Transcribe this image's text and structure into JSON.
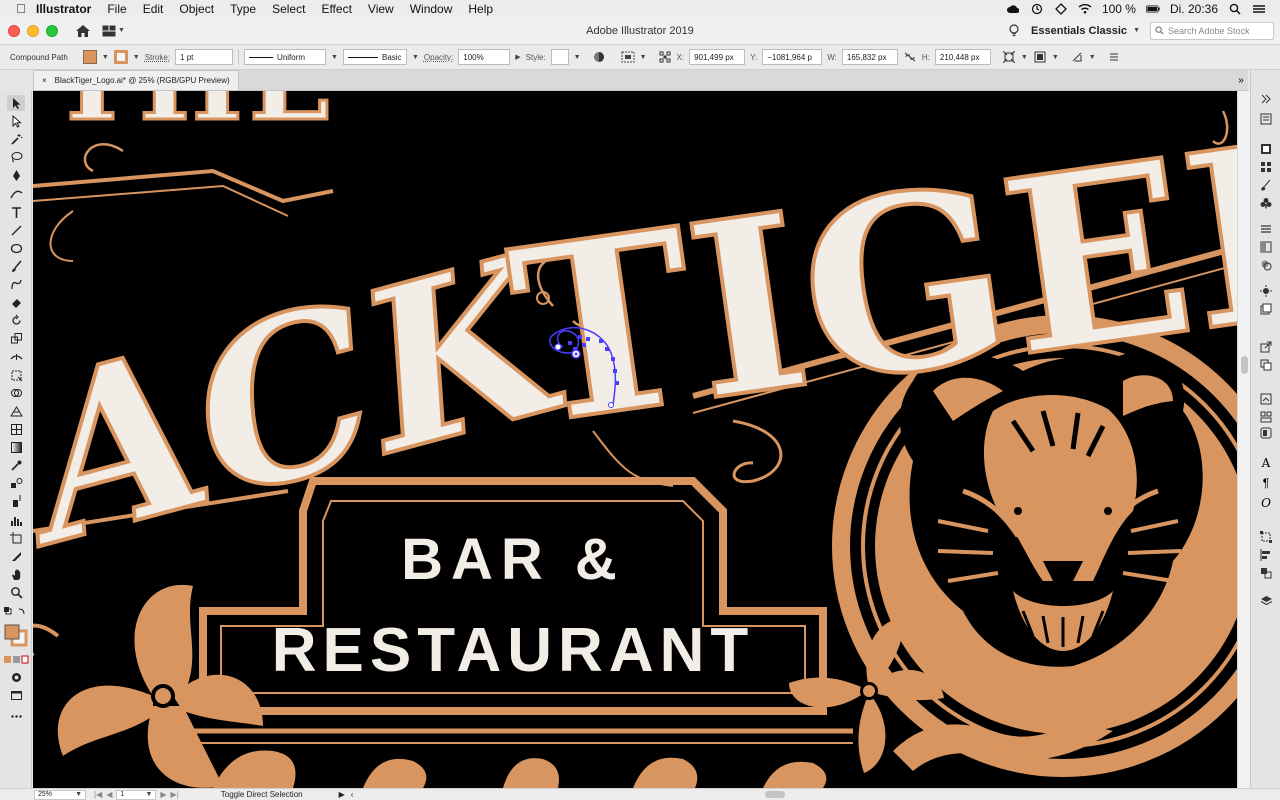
{
  "menubar": {
    "app_name": "Illustrator",
    "items": [
      "File",
      "Edit",
      "Object",
      "Type",
      "Select",
      "Effect",
      "View",
      "Window",
      "Help"
    ],
    "battery": "100 %",
    "clock": "Di. 20:36"
  },
  "titlebar": {
    "title": "Adobe Illustrator 2019",
    "workspace": "Essentials Classic",
    "search_placeholder": "Search Adobe Stock"
  },
  "controlbar": {
    "selection_type": "Compound Path",
    "stroke_label": "Stroke:",
    "stroke_value": "1 pt",
    "profile": "Uniform",
    "brush": "Basic",
    "opacity_label": "Opacity:",
    "opacity_value": "100%",
    "style_label": "Style:",
    "x_label": "X:",
    "x_value": "901,499 px",
    "y_label": "Y:",
    "y_value": "−1081,964 p",
    "w_label": "W:",
    "w_value": "165,832 px",
    "h_label": "H:",
    "h_value": "210,448 px",
    "fill_color": "#d9955f"
  },
  "doc_tab": {
    "close": "×",
    "label": "BlackTiger_Logo.ai* @ 25% (RGB/GPU Preview)"
  },
  "artwork": {
    "word_the": "THE",
    "word_black": "ACK",
    "word_tiger": "TIGER",
    "line1": "BAR &",
    "line2": "RESTAURANT",
    "cream": "#f3ede8",
    "copper": "#d9955f",
    "selection": "#4b3cff"
  },
  "statusbar": {
    "zoom": "25%",
    "artboard": "1",
    "status_text": "Toggle Direct Selection"
  }
}
